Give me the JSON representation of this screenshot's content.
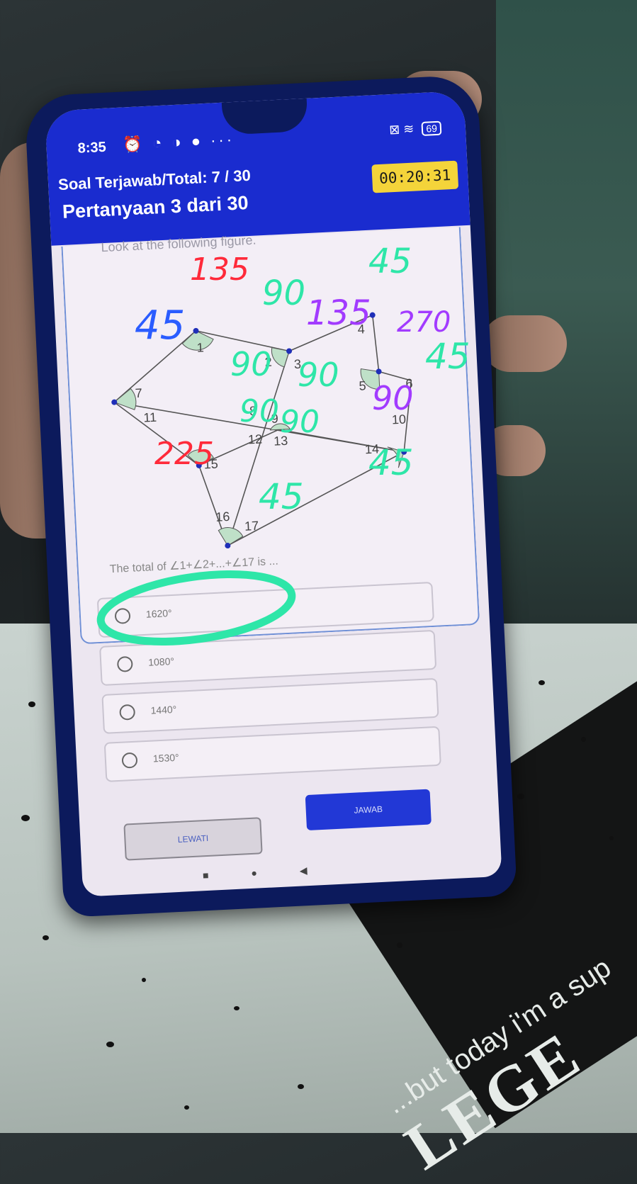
{
  "status_bar": {
    "time": "8:35",
    "icons_left": "⏰ ◔ ◑ ● ···",
    "battery": "69",
    "icons_right": "⊠ ≋"
  },
  "header": {
    "answered": "Soal Terjawab/Total: 7 / 30",
    "question_number": "Pertanyaan 3 dari 30",
    "timer": "00:20:31"
  },
  "question": {
    "intro": "Look at the following figure.",
    "text": "The total of ∠1+∠2+...+∠17 is ...",
    "figure_labels": [
      "1",
      "2",
      "3",
      "4",
      "5",
      "6",
      "7",
      "8",
      "9",
      "10",
      "11",
      "12",
      "13",
      "14",
      "15",
      "16",
      "17"
    ]
  },
  "options": [
    {
      "label": "1620°"
    },
    {
      "label": "1080°"
    },
    {
      "label": "1440°"
    },
    {
      "label": "1530°"
    }
  ],
  "buttons": {
    "skip": "LEWATI",
    "answer": "JAWAB"
  },
  "handwriting": [
    "135",
    "90",
    "45",
    "135",
    "45",
    "270",
    "45",
    "90",
    "90",
    "90",
    "90",
    "90",
    "225",
    "45",
    "45"
  ],
  "shirt": {
    "main": "LEGE",
    "sub": "...but today i'm a sup"
  },
  "colors": {
    "header_blue": "#1a2ccf",
    "timer_yellow": "#f4d43a",
    "ink_green": "#2ee6a8",
    "ink_red": "#ff2a3a",
    "ink_blue": "#2a5cff",
    "ink_purple": "#a23bff"
  }
}
